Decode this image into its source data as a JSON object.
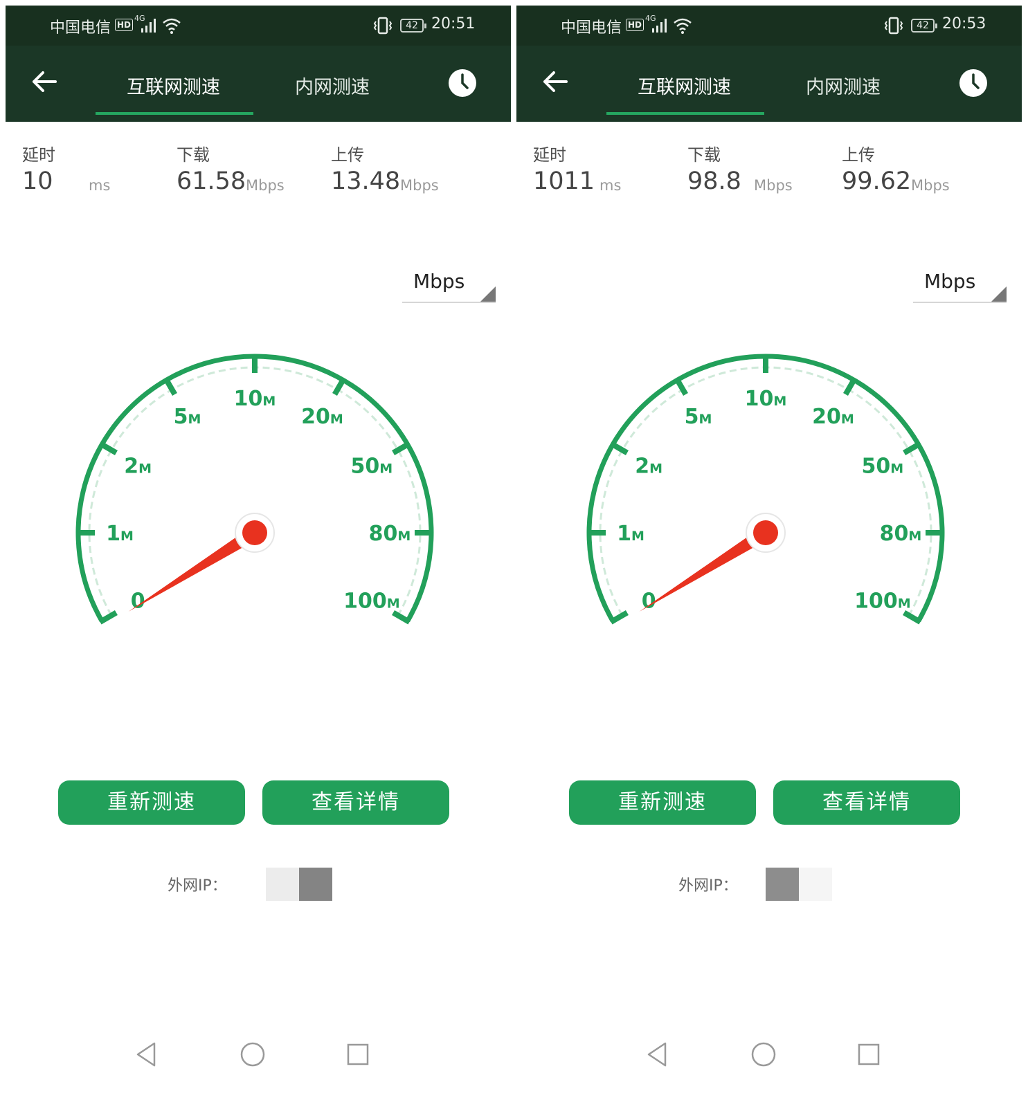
{
  "theme": {
    "accent": "#22a05a",
    "header_bg": "#1b3726",
    "needle": "#e8321f"
  },
  "screens": [
    {
      "status": {
        "carrier": "中国电信",
        "hd": "HD",
        "network": "4G",
        "battery": "42",
        "time": "20:51"
      },
      "tabs": {
        "active": "互联网测速",
        "inactive": "内网测速"
      },
      "metrics": {
        "latency": {
          "label": "延时",
          "value": "10",
          "unit": "ms"
        },
        "download": {
          "label": "下载",
          "value": "61.58",
          "unit": "Mbps"
        },
        "upload": {
          "label": "上传",
          "value": "13.48",
          "unit": "Mbps"
        }
      },
      "unit_select": "Mbps",
      "gauge": {
        "ticks": [
          "0",
          "1",
          "2",
          "5",
          "10",
          "20",
          "50",
          "80",
          "100"
        ],
        "suffix": "M",
        "needle_value": 0
      },
      "buttons": {
        "retest": "重新测速",
        "detail": "查看详情"
      },
      "ip_label": "外网IP："
    },
    {
      "status": {
        "carrier": "中国电信",
        "hd": "HD",
        "network": "4G",
        "battery": "42",
        "time": "20:53"
      },
      "tabs": {
        "active": "互联网测速",
        "inactive": "内网测速"
      },
      "metrics": {
        "latency": {
          "label": "延时",
          "value": "1011",
          "unit": "ms"
        },
        "download": {
          "label": "下载",
          "value": "98.8",
          "unit": "Mbps"
        },
        "upload": {
          "label": "上传",
          "value": "99.62",
          "unit": "Mbps"
        }
      },
      "unit_select": "Mbps",
      "gauge": {
        "ticks": [
          "0",
          "1",
          "2",
          "5",
          "10",
          "20",
          "50",
          "80",
          "100"
        ],
        "suffix": "M",
        "needle_value": 0
      },
      "buttons": {
        "retest": "重新测速",
        "detail": "查看详情"
      },
      "ip_label": "外网IP："
    }
  ]
}
